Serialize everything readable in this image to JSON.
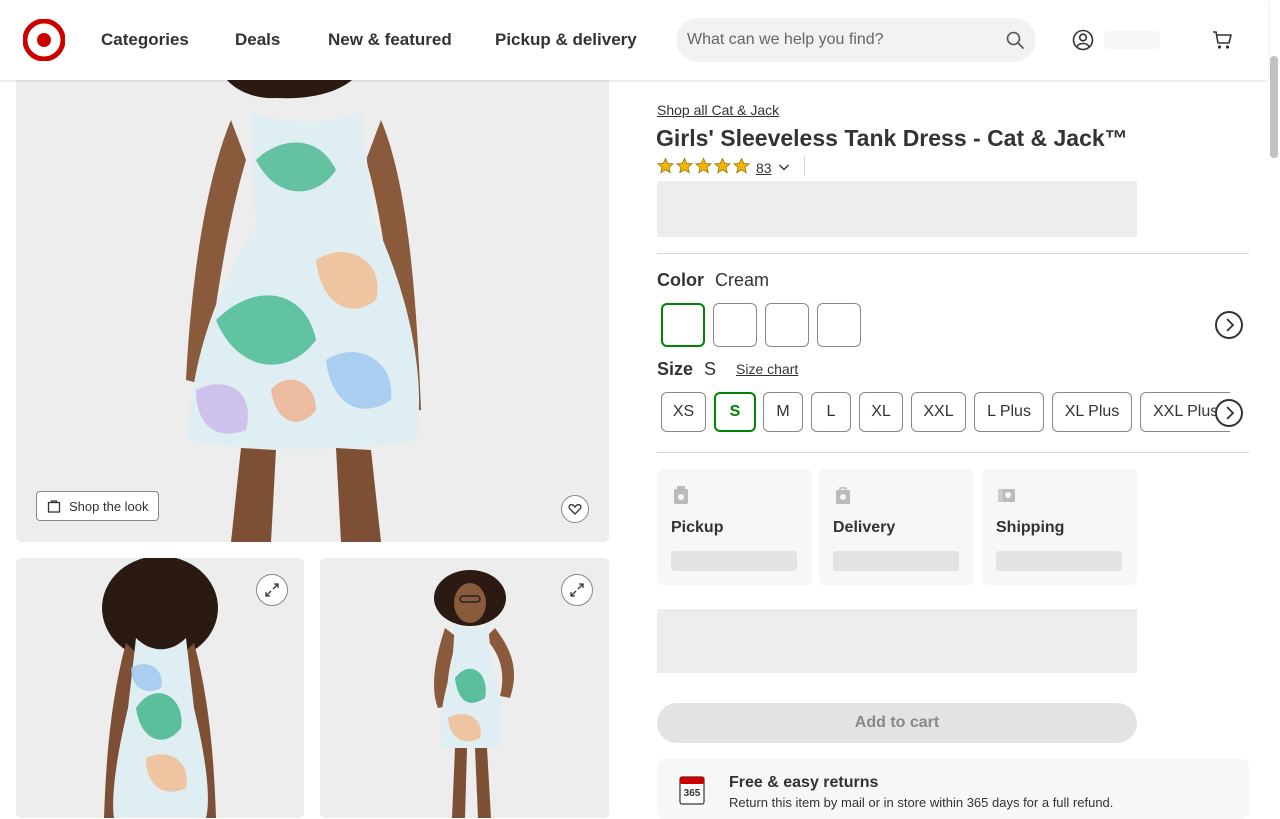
{
  "header": {
    "nav": [
      "Categories",
      "Deals",
      "New & featured",
      "Pickup & delivery"
    ],
    "search_placeholder": "What can we help you find?",
    "brand_color": "#cc0000"
  },
  "gallery": {
    "shop_look_label": "Shop the look"
  },
  "product": {
    "brand_link": "Shop all Cat & Jack",
    "title": "Girls' Sleeveless Tank Dress - Cat & Jack™",
    "rating_stars": 5,
    "rating_count": "83",
    "star_color": "#f4b400"
  },
  "color": {
    "label": "Color",
    "value": "Cream",
    "swatch_count": 4
  },
  "size": {
    "label": "Size",
    "value": "S",
    "chart_link": "Size chart",
    "options": [
      "XS",
      "S",
      "M",
      "L",
      "XL",
      "XXL",
      "L Plus",
      "XL Plus",
      "XXL Plus"
    ],
    "selected": "S",
    "selected_color": "#008300"
  },
  "fulfillment": {
    "pickup": "Pickup",
    "delivery": "Delivery",
    "shipping": "Shipping"
  },
  "cart": {
    "add_label": "Add to cart"
  },
  "returns": {
    "icon_text": "365",
    "title": "Free & easy returns",
    "desc": "Return this item by mail or in store within 365 days for a full refund."
  }
}
